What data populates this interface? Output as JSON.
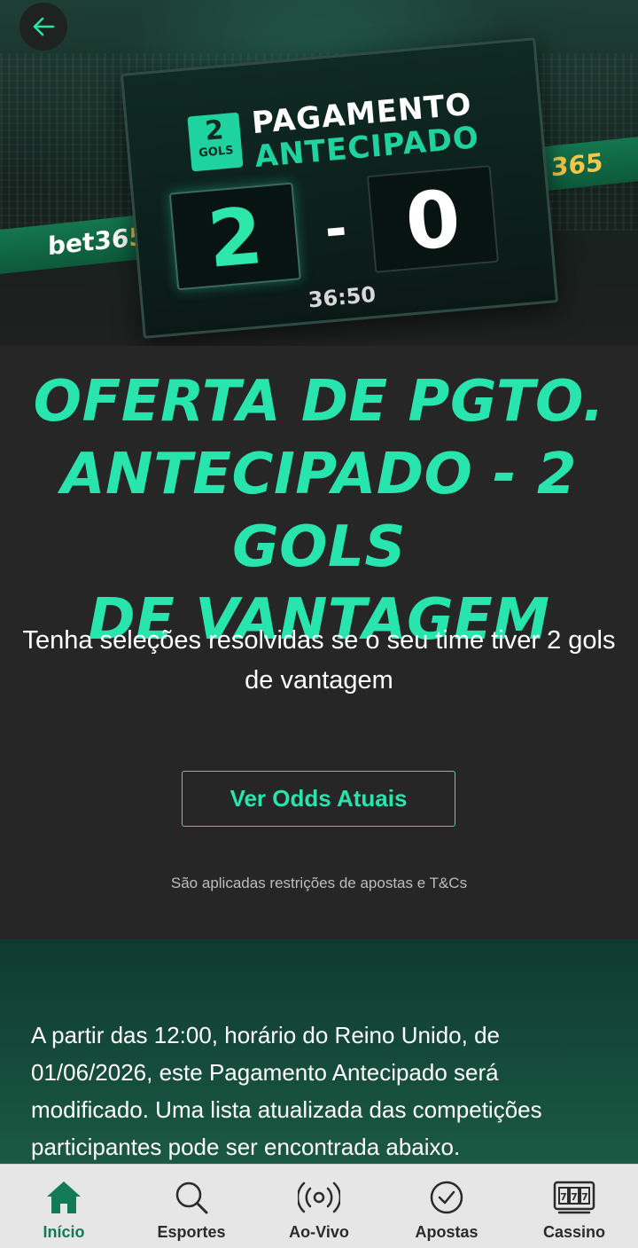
{
  "hero": {
    "scoreboard": {
      "badge_number": "2",
      "badge_label": "GOLS",
      "title_line1": "PAGAMENTO",
      "title_line2": "ANTECIPADO",
      "home_score": "2",
      "separator": "-",
      "away_score": "0",
      "clock": "36:50"
    },
    "ad_left_brand": "bet36",
    "ad_left_accent": "5",
    "ad_right_brand": "365"
  },
  "main": {
    "headline_line1": "OFERTA DE PGTO.",
    "headline_line2": "ANTECIPADO - 2 GOLS",
    "headline_line3": "DE VANTAGEM",
    "subtitle": "Tenha seleções resolvidas se o seu time tiver 2 gols de vantagem",
    "cta_label": "Ver Odds Atuais",
    "terms": "São aplicadas restrições de apostas e T&Cs"
  },
  "info": {
    "text": "A partir das 12:00, horário do Reino Unido, de 01/06/2026, este Pagamento Antecipado será modificado. Uma lista atualizada das competições participantes pode ser encontrada abaixo."
  },
  "bottom_nav": {
    "items": [
      {
        "label": "Início",
        "icon": "home-icon",
        "active": true
      },
      {
        "label": "Esportes",
        "icon": "search-icon",
        "active": false
      },
      {
        "label": "Ao-Vivo",
        "icon": "live-broadcast-icon",
        "active": false
      },
      {
        "label": "Apostas",
        "icon": "check-circle-icon",
        "active": false
      },
      {
        "label": "Cassino",
        "icon": "slot-machine-icon",
        "active": false
      }
    ]
  },
  "colors": {
    "accent": "#27e5ad",
    "active_nav": "#127a57",
    "background": "#262626",
    "info_panel": "#1b5a45"
  }
}
